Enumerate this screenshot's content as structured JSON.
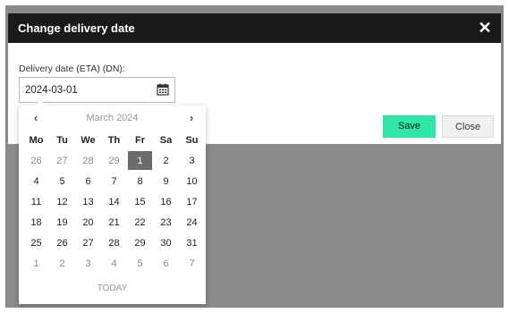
{
  "dialog": {
    "title": "Change delivery date",
    "close_glyph": "✕",
    "field_label": "Delivery date (ETA) (DN):",
    "date_value": "2024-03-01",
    "save_label": "Save",
    "close_label": "Close"
  },
  "colors": {
    "header_bg": "#1a1a1a",
    "save_bg": "#2ee6a8",
    "selected_day_bg": "#6b6b6b",
    "overlay": "#8a8a8a"
  },
  "datepicker": {
    "prev_glyph": "‹",
    "next_glyph": "›",
    "month_label": "March 2024",
    "today_label": "TODAY",
    "weekdays": [
      "Mo",
      "Tu",
      "We",
      "Th",
      "Fr",
      "Sa",
      "Su"
    ],
    "selected": "1",
    "weeks": [
      [
        {
          "d": "26",
          "m": true
        },
        {
          "d": "27",
          "m": true
        },
        {
          "d": "28",
          "m": true
        },
        {
          "d": "29",
          "m": true
        },
        {
          "d": "1",
          "m": false,
          "s": true
        },
        {
          "d": "2",
          "m": false
        },
        {
          "d": "3",
          "m": false
        }
      ],
      [
        {
          "d": "4",
          "m": false
        },
        {
          "d": "5",
          "m": false
        },
        {
          "d": "6",
          "m": false
        },
        {
          "d": "7",
          "m": false
        },
        {
          "d": "8",
          "m": false
        },
        {
          "d": "9",
          "m": false
        },
        {
          "d": "10",
          "m": false
        }
      ],
      [
        {
          "d": "11",
          "m": false
        },
        {
          "d": "12",
          "m": false
        },
        {
          "d": "13",
          "m": false
        },
        {
          "d": "14",
          "m": false
        },
        {
          "d": "15",
          "m": false
        },
        {
          "d": "16",
          "m": false
        },
        {
          "d": "17",
          "m": false
        }
      ],
      [
        {
          "d": "18",
          "m": false
        },
        {
          "d": "19",
          "m": false
        },
        {
          "d": "20",
          "m": false
        },
        {
          "d": "21",
          "m": false
        },
        {
          "d": "22",
          "m": false
        },
        {
          "d": "23",
          "m": false
        },
        {
          "d": "24",
          "m": false
        }
      ],
      [
        {
          "d": "25",
          "m": false
        },
        {
          "d": "26",
          "m": false
        },
        {
          "d": "27",
          "m": false
        },
        {
          "d": "28",
          "m": false
        },
        {
          "d": "29",
          "m": false
        },
        {
          "d": "30",
          "m": false
        },
        {
          "d": "31",
          "m": false
        }
      ],
      [
        {
          "d": "1",
          "m": true
        },
        {
          "d": "2",
          "m": true
        },
        {
          "d": "3",
          "m": true
        },
        {
          "d": "4",
          "m": true
        },
        {
          "d": "5",
          "m": true
        },
        {
          "d": "6",
          "m": true
        },
        {
          "d": "7",
          "m": true
        }
      ]
    ]
  }
}
